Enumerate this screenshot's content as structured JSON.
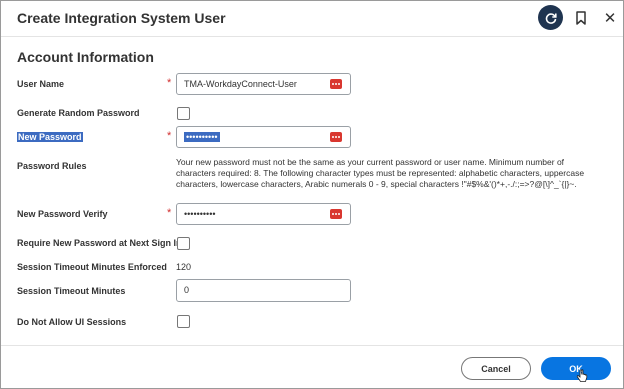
{
  "dialog": {
    "title": "Create Integration System User",
    "close_glyph": "✕"
  },
  "icons": {
    "refresh": "refresh-icon",
    "bookmark": "bookmark-icon",
    "close": "close-icon",
    "password": "password-dots-icon"
  },
  "section": {
    "title": "Account Information"
  },
  "form": {
    "user_name": {
      "label": "User Name",
      "value": "TMA-WorkdayConnect-User",
      "required": "*"
    },
    "generate_random_password": {
      "label": "Generate Random Password"
    },
    "new_password": {
      "label": "New Password",
      "value": "••••••••••",
      "required": "*"
    },
    "password_rules": {
      "label": "Password Rules",
      "text": "Your new password must not be the same as your current password or user name. Minimum number of characters required: 8. The following character types must be represented: alphabetic characters, uppercase characters, lowercase characters, Arabic numerals 0 - 9, special characters !\"#$%&'()*+,-./:;=>?@[\\]^_`{|}~."
    },
    "new_password_verify": {
      "label": "New Password Verify",
      "value": "••••••••••",
      "required": "*"
    },
    "require_new_password": {
      "label": "Require New Password at Next Sign In"
    },
    "session_timeout_enforced": {
      "label": "Session Timeout Minutes Enforced",
      "value": "120"
    },
    "session_timeout_minutes": {
      "label": "Session Timeout Minutes",
      "value": "0"
    },
    "do_not_allow_ui_sessions": {
      "label": "Do Not Allow UI Sessions"
    }
  },
  "footer": {
    "cancel_label": "Cancel",
    "ok_label": "OK"
  },
  "colors": {
    "primary_button": "#0875e1",
    "required_star": "#d12e2e",
    "password_icon": "#d9372f",
    "selection": "#3c6bc1",
    "refresh_button": "#1f3450"
  }
}
